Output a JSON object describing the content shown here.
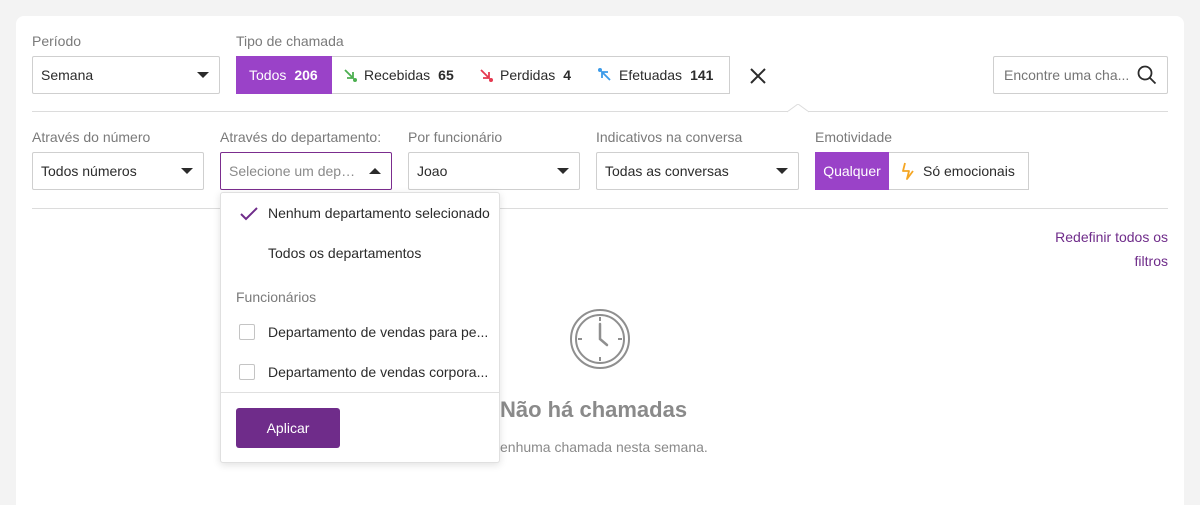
{
  "period": {
    "label": "Período",
    "value": "Semana"
  },
  "call_type": {
    "label": "Tipo de chamada",
    "segments": [
      {
        "label": "Todos",
        "count": "206"
      },
      {
        "label": "Recebidas",
        "count": "65"
      },
      {
        "label": "Perdidas",
        "count": "4"
      },
      {
        "label": "Efetuadas",
        "count": "141"
      }
    ]
  },
  "search": {
    "placeholder": "Encontre uma cha..."
  },
  "filters": {
    "number": {
      "label": "Através do número",
      "value": "Todos números"
    },
    "department": {
      "label": "Através do departamento:",
      "placeholder": "Selecione um depart..."
    },
    "employee": {
      "label": "Por funcionário",
      "value": "Joao"
    },
    "indicators": {
      "label": "Indicativos na conversa",
      "value": "Todas as conversas"
    },
    "emotivity": {
      "label": "Emotividade",
      "options": [
        "Qualquer",
        "Só emocionais"
      ]
    }
  },
  "department_dropdown": {
    "option_none": "Nenhum departamento selecionado",
    "option_all": "Todos os departamentos",
    "group_label": "Funcionários",
    "items": [
      "Departamento de vendas para pe...",
      "Departamento de vendas corpora..."
    ],
    "apply_label": "Aplicar"
  },
  "reset_link": {
    "line1": "Redefinir todos os",
    "line2": "filtros"
  },
  "empty_state": {
    "title": "Não há chamadas",
    "subtitle": "enhuma chamada nesta semana."
  },
  "colors": {
    "accent": "#9a42c8",
    "accent_dark": "#6f2c8a",
    "received": "#4caf50",
    "missed": "#e53950",
    "outgoing": "#3d9be9",
    "emotion": "#f5a623"
  },
  "icons": [
    "arrow-received-icon",
    "arrow-missed-icon",
    "arrow-outgoing-icon",
    "close-icon",
    "search-icon",
    "lightning-icon",
    "check-icon",
    "clock-icon"
  ]
}
